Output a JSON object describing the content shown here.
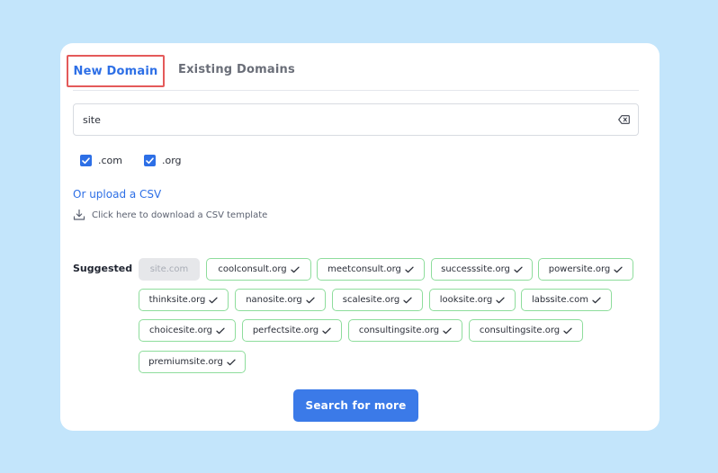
{
  "tabs": {
    "new_domain": "New Domain",
    "existing_domains": "Existing Domains"
  },
  "search": {
    "value": "site"
  },
  "extensions": [
    {
      "label": ".com",
      "checked": true
    },
    {
      "label": ".org",
      "checked": true
    }
  ],
  "upload": {
    "link_text": "Or upload a CSV",
    "download_text": "Click here to download a CSV template"
  },
  "suggested": {
    "label": "Suggested",
    "chips": [
      {
        "text": "site.com",
        "available": false
      },
      {
        "text": "coolconsult.org",
        "available": true
      },
      {
        "text": "meetconsult.org",
        "available": true
      },
      {
        "text": "successsite.org",
        "available": true
      },
      {
        "text": "powersite.org",
        "available": true
      },
      {
        "text": "thinksite.org",
        "available": true
      },
      {
        "text": "nanosite.org",
        "available": true
      },
      {
        "text": "scalesite.org",
        "available": true
      },
      {
        "text": "looksite.org",
        "available": true
      },
      {
        "text": "labssite.com",
        "available": true
      },
      {
        "text": "choicesite.org",
        "available": true
      },
      {
        "text": "perfectsite.org",
        "available": true
      },
      {
        "text": "consultingsite.org",
        "available": true
      },
      {
        "text": "consultingsite.org",
        "available": true
      },
      {
        "text": "premiumsite.org",
        "available": true
      }
    ]
  },
  "search_more_label": "Search for more",
  "colors": {
    "background": "#c3e5fb",
    "accent": "#2d6fe6",
    "button": "#3b7ae8",
    "chip_border": "#8edd9c",
    "tab_highlight": "#e45a5a"
  }
}
